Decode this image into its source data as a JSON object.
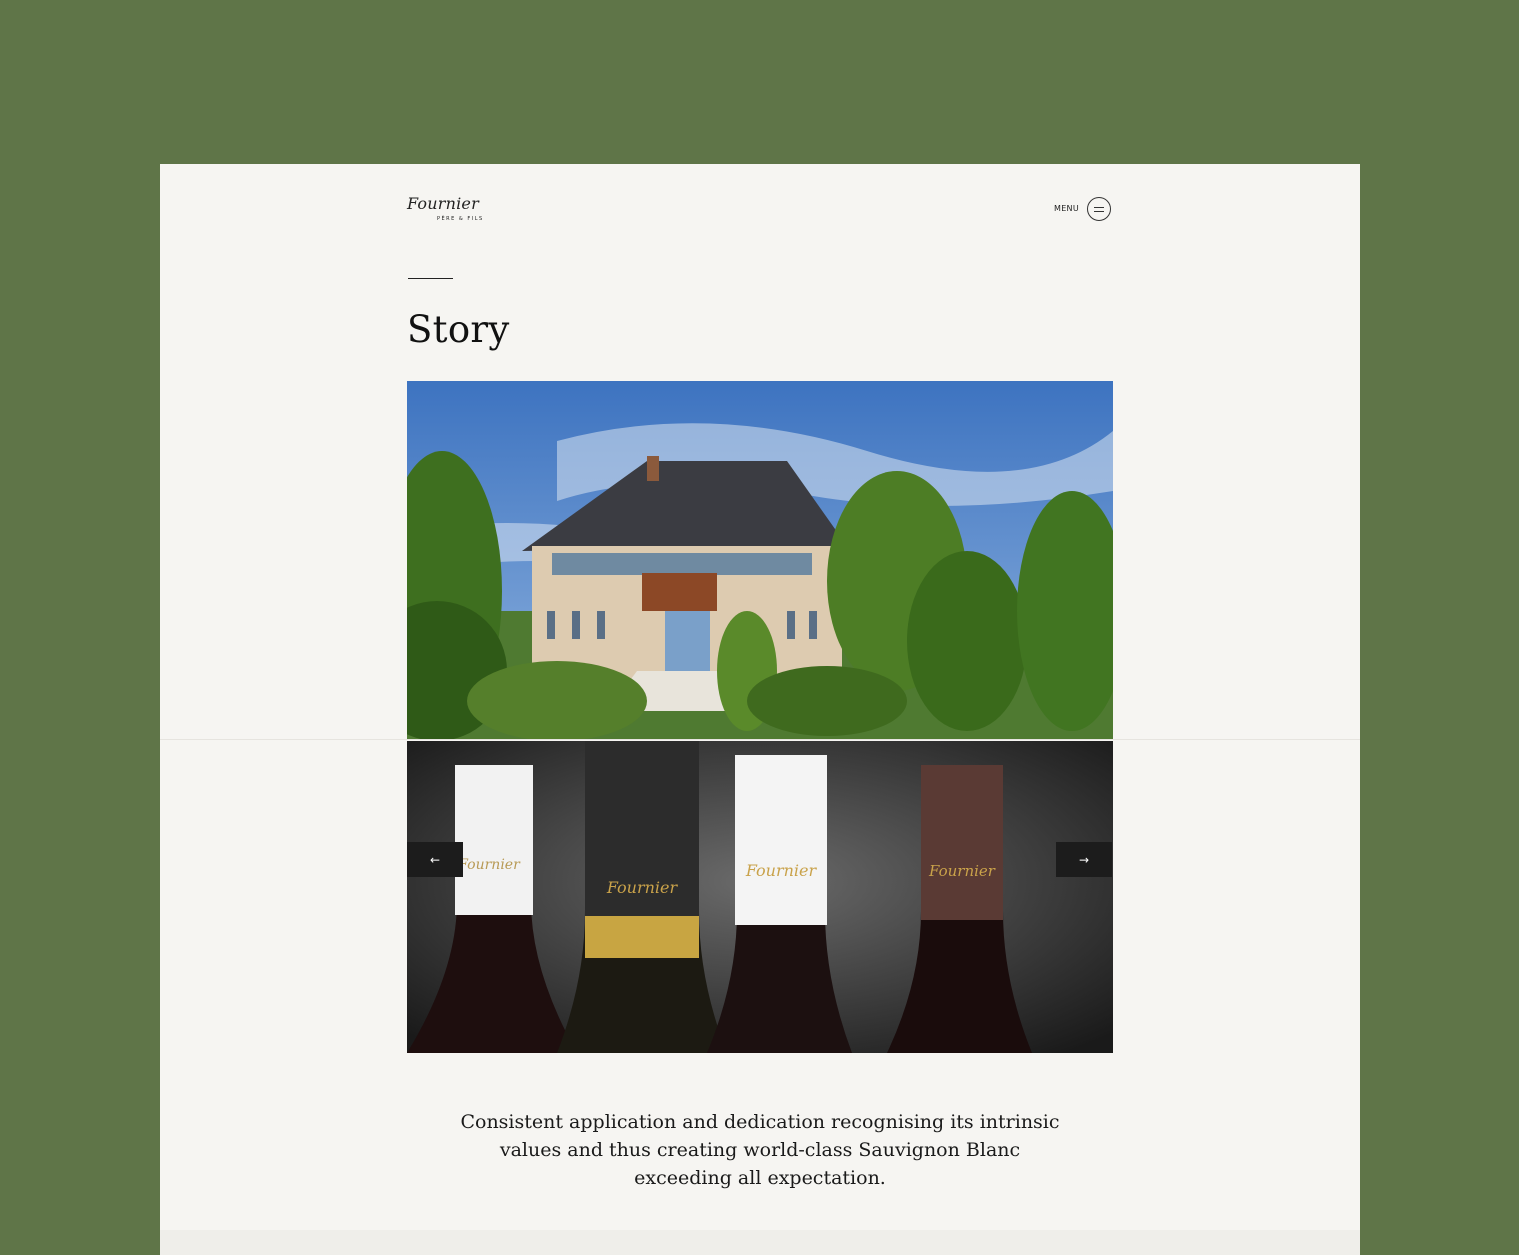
{
  "brand": {
    "logo_text": "Fournier",
    "logo_subtext": "PÈRE & FILS"
  },
  "header": {
    "menu_label": "MENU"
  },
  "page": {
    "title": "Story"
  },
  "slider": {
    "prev_label": "←",
    "next_label": "→"
  },
  "intro": {
    "text": "Consistent application and dedication recognising its intrinsic values and thus creating world-class Sauvignon Blanc exceeding all expectation."
  },
  "colors": {
    "background": "#5f7548",
    "card": "#f6f5f2",
    "text": "#1a1a1a"
  }
}
